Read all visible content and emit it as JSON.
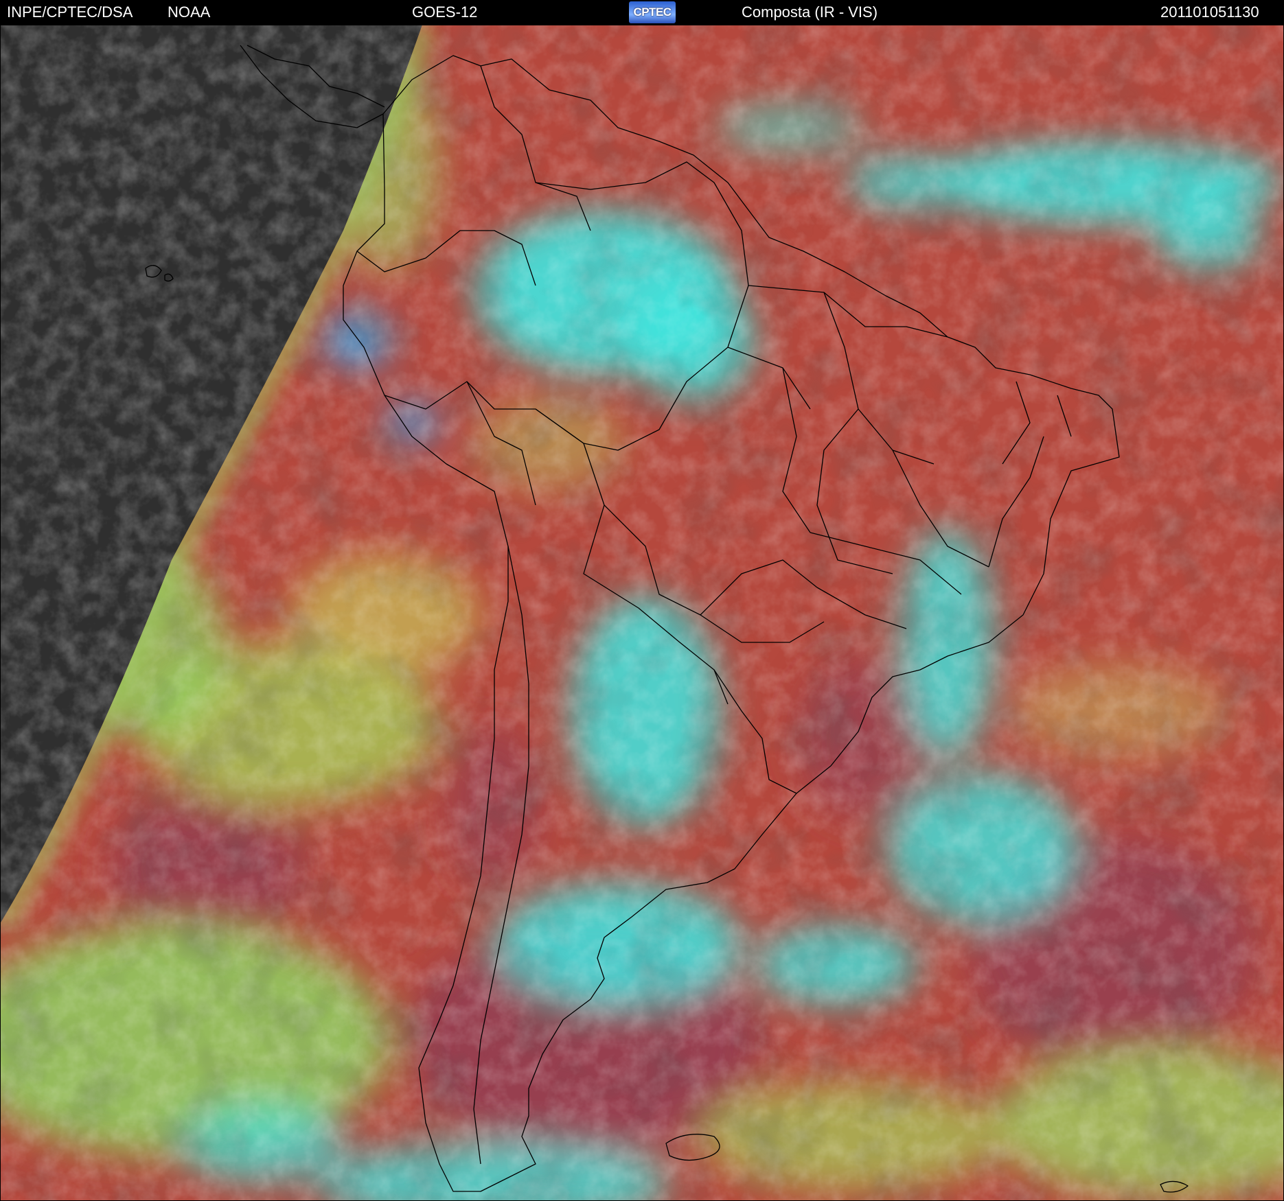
{
  "header": {
    "agency": "INPE/CPTEC/DSA",
    "source": "NOAA",
    "satellite": "GOES-12",
    "logo_text": "CPTEC",
    "product": "Composta (IR - VIS)",
    "timestamp": "201101051130"
  },
  "colors": {
    "night_side": "#2f2f2f",
    "clear_surface": "#b5483d",
    "cold_ocean": "#943f52",
    "low_cloud": "#8fd060",
    "high_cloud": "#40e6e0",
    "deep_cloud": "#38a8f0",
    "boundaries": "#000000"
  }
}
